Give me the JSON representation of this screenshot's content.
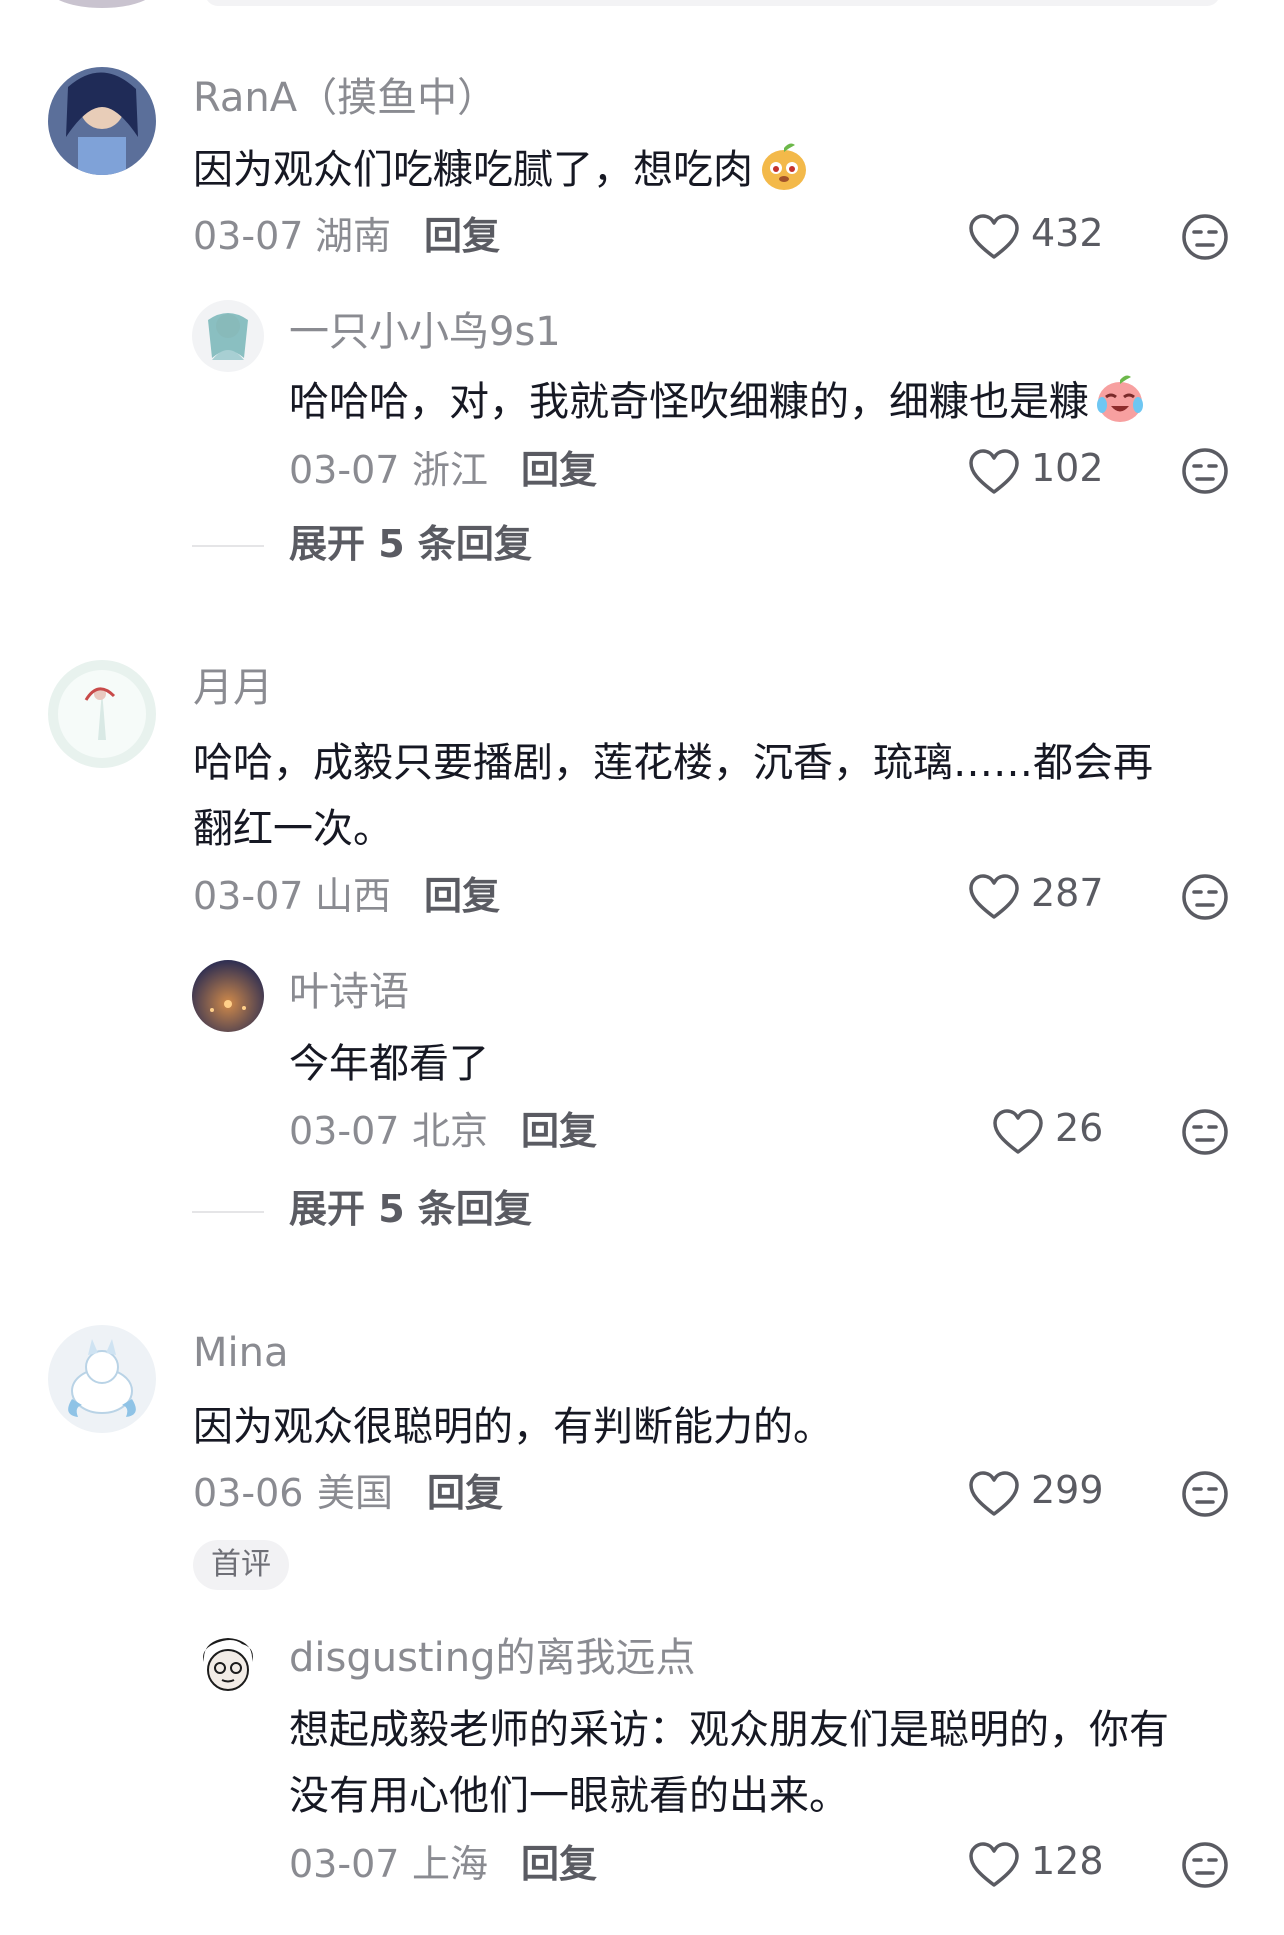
{
  "comments": [
    {
      "user": "RanA（摸鱼中）",
      "text": "因为观众们吃糠吃腻了，想吃肉",
      "emoji": "sweet-potato-face-emoji",
      "date": "03-07",
      "location": "湖南",
      "reply_label": "回复",
      "likes": "432",
      "replies": [
        {
          "user": "一只小小鸟9s1",
          "text": "哈哈哈，对，我就奇怪吹细糠的，细糠也是糠",
          "emoji": "crying-laughing-peach-emoji",
          "date": "03-07",
          "location": "浙江",
          "reply_label": "回复",
          "likes": "102"
        }
      ],
      "expand_label": "展开 5 条回复"
    },
    {
      "user": "月月",
      "text_lines": [
        "哈哈，成毅只要播剧，莲花楼，沉香，琉璃……都会再",
        "翻红一次。"
      ],
      "date": "03-07",
      "location": "山西",
      "reply_label": "回复",
      "likes": "287",
      "replies": [
        {
          "user": "叶诗语",
          "text": "今年都看了",
          "date": "03-07",
          "location": "北京",
          "reply_label": "回复",
          "likes": "26"
        }
      ],
      "expand_label": "展开 5 条回复"
    },
    {
      "user": "Mina",
      "text": "因为观众很聪明的，有判断能力的。",
      "date": "03-06",
      "location": "美国",
      "reply_label": "回复",
      "likes": "299",
      "badge": "首评",
      "replies": [
        {
          "user": "disgusting的离我远点",
          "text_lines": [
            "想起成毅老师的采访：观众朋友们是聪明的，你有",
            "没有用心他们一眼就看的出来。"
          ],
          "date": "03-07",
          "location": "上海",
          "reply_label": "回复",
          "likes": "128"
        }
      ]
    }
  ],
  "colors": {
    "primary_text": "#161823",
    "secondary_text": "#8a8b91",
    "action_text": "#5a5b62",
    "background": "#ffffff"
  }
}
